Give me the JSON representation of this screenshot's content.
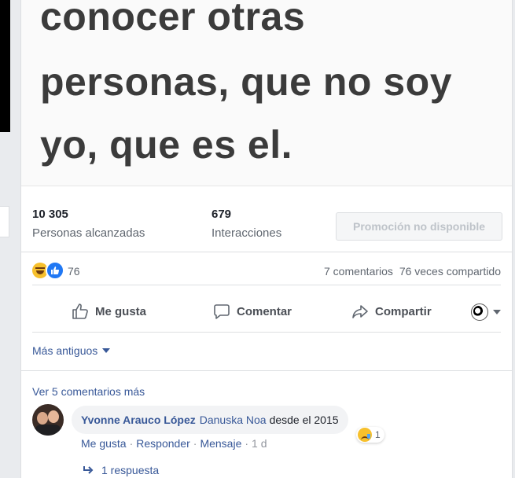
{
  "post_image": {
    "lines": [
      "conocer otras",
      "personas, que no soy",
      "yo, que es el."
    ]
  },
  "insights": {
    "reach_value": "10 305",
    "reach_label": "Personas alcanzadas",
    "engagement_value": "679",
    "engagement_label": "Interacciones",
    "promote_label": "Promoción no disponible"
  },
  "reactions": {
    "count": "76",
    "comments": "7 comentarios",
    "shares": "76 veces compartido",
    "icons": [
      "haha-icon",
      "like-icon"
    ]
  },
  "actions": {
    "like": "Me gusta",
    "comment": "Comentar",
    "share": "Compartir"
  },
  "comments": {
    "sort_label": "Más antiguos",
    "view_more": "Ver 5 comentarios más",
    "items": [
      {
        "author": "Yvonne Arauco López",
        "mention": "Danuska Noa",
        "text": "desde el 2015",
        "reaction_count": "1",
        "like": "Me gusta",
        "reply": "Responder",
        "message": "Mensaje",
        "time": "1 d",
        "replies": "1 respuesta"
      }
    ]
  },
  "colors": {
    "link": "#385898",
    "like_blue": "#2078f4",
    "emoji_yellow": "#f7c02c"
  }
}
